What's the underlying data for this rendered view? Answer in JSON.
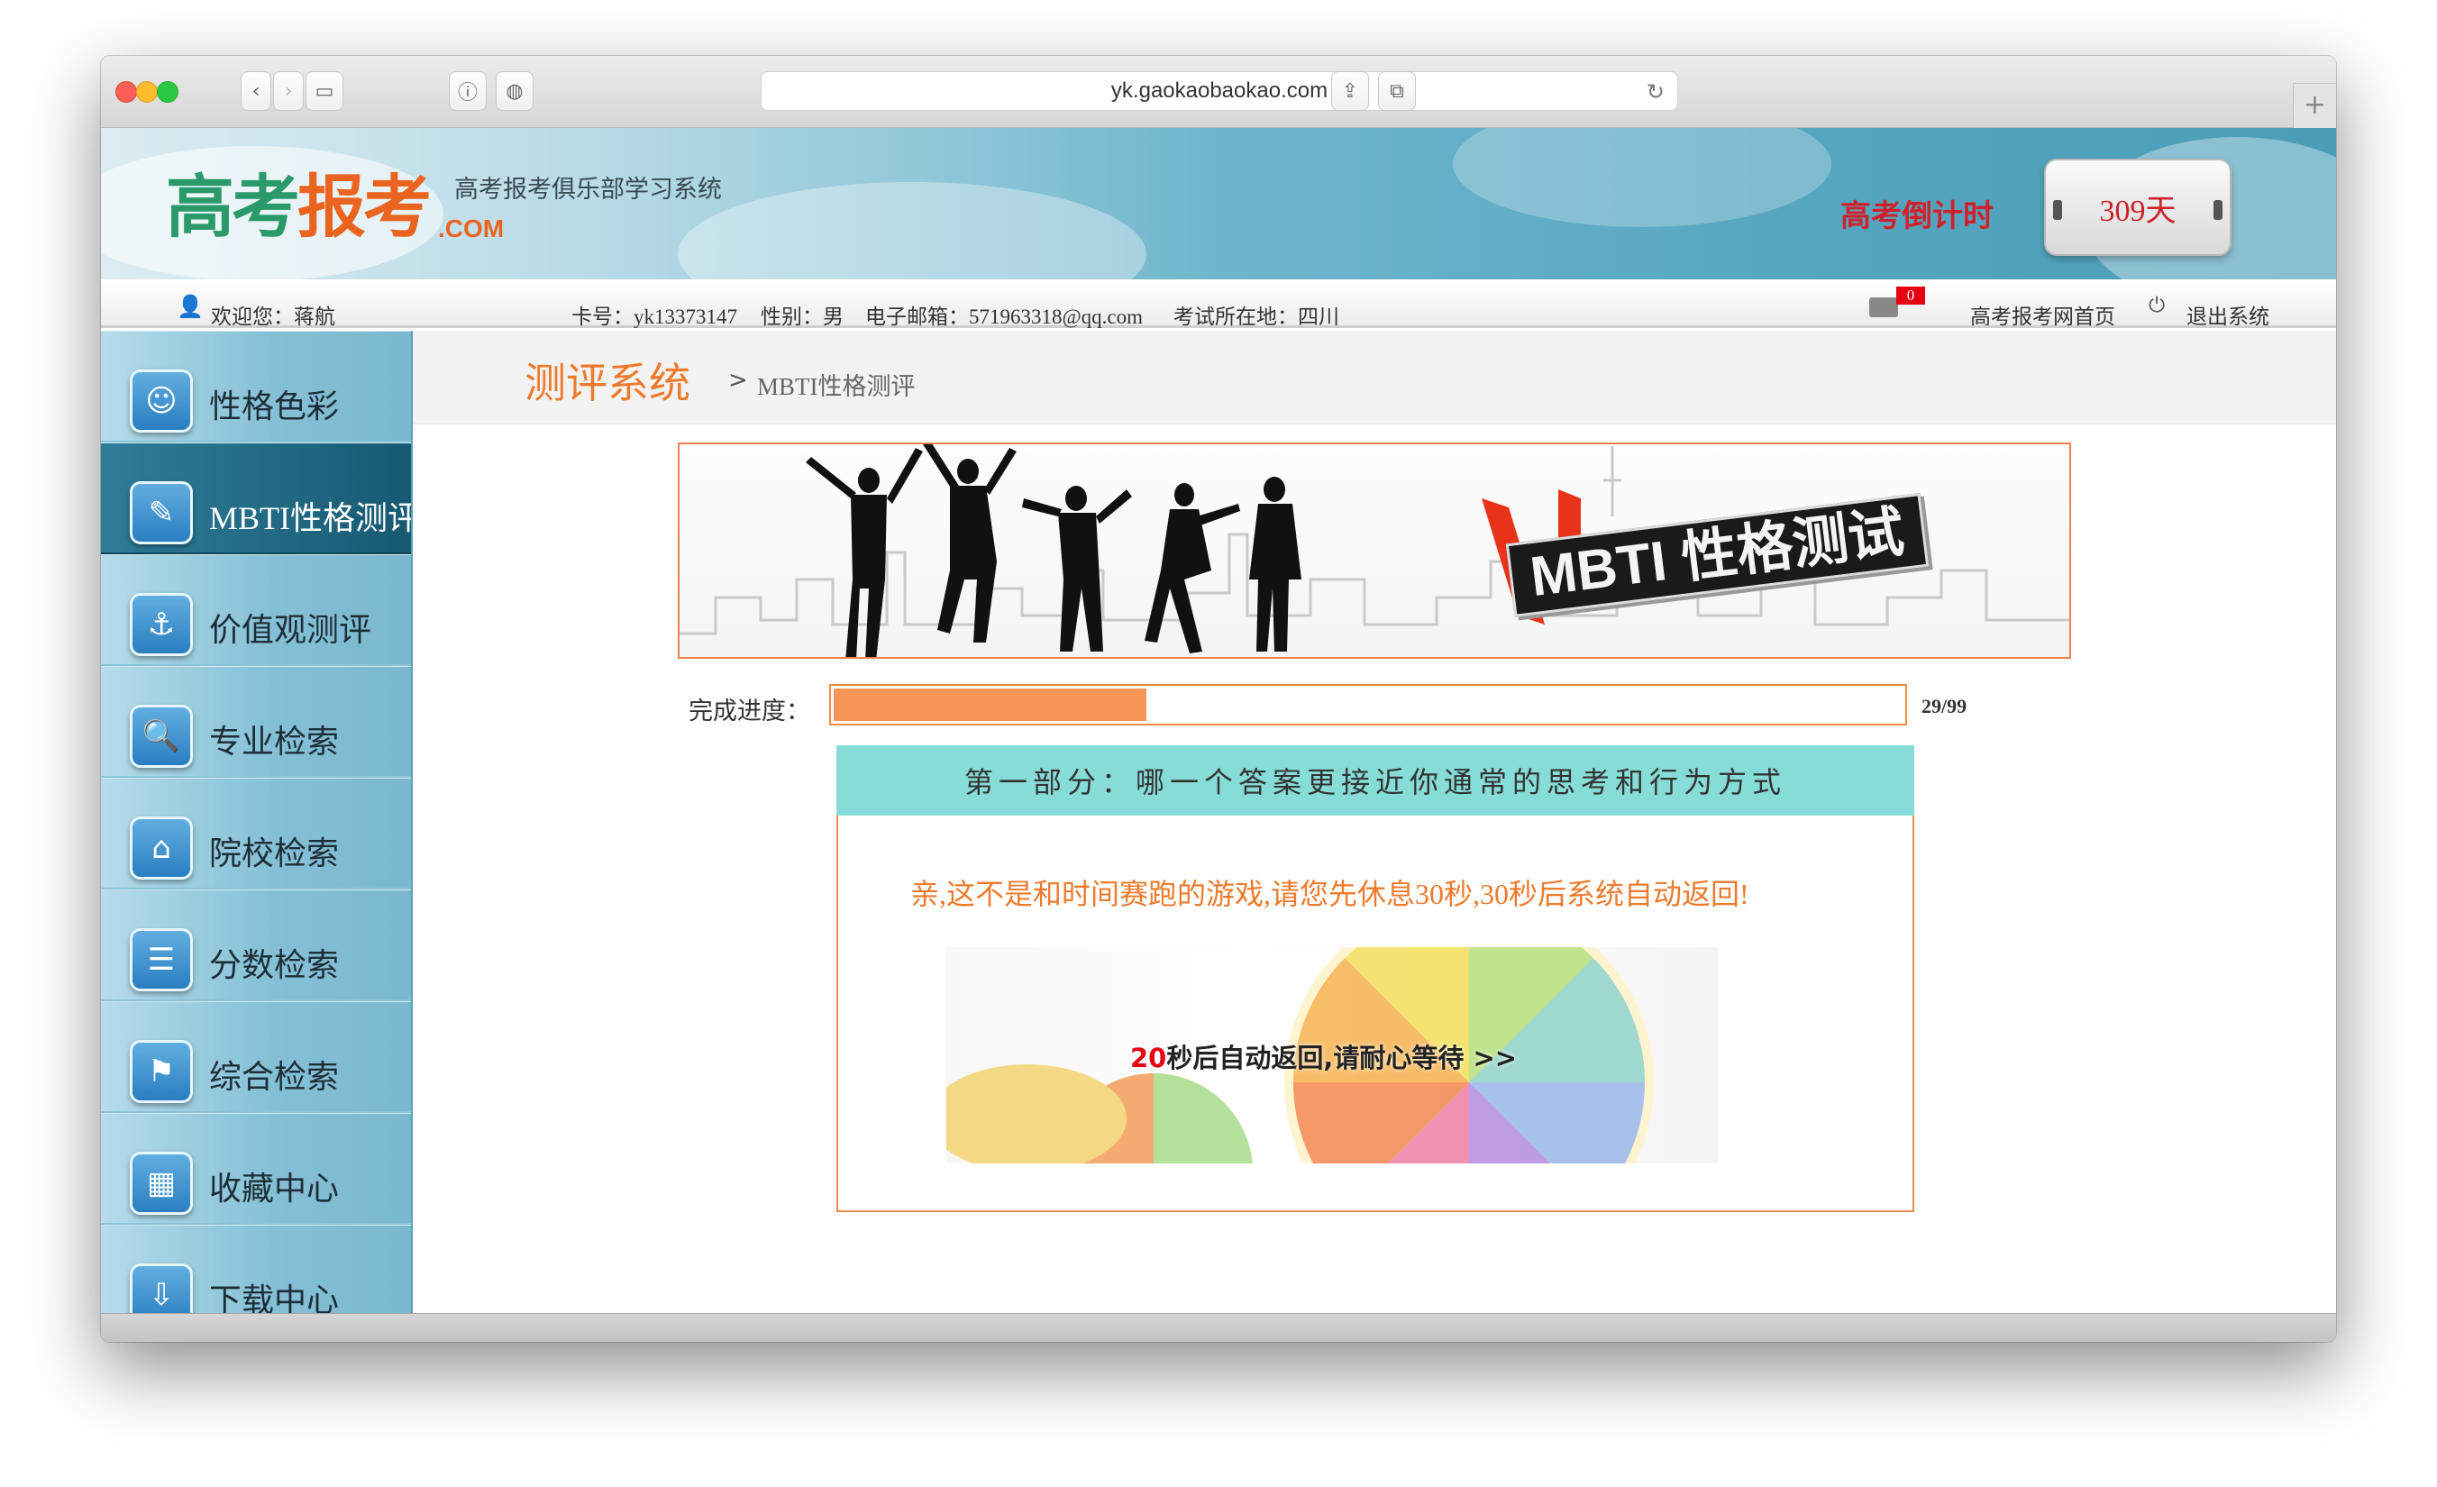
{
  "browser": {
    "url": "yk.gaokaobaokao.com",
    "icons": [
      "back-icon",
      "forward-icon",
      "sidebar-icon",
      "info-icon",
      "shield-icon",
      "reload-icon",
      "share-icon",
      "tabs-icon",
      "new-tab-icon"
    ]
  },
  "header": {
    "logo_part1": "高考",
    "logo_part2": "报考",
    "logo_com": ".COM",
    "slogan": "高考报考俱乐部学习系统",
    "countdown_label": "高考倒计时",
    "countdown_value": "309天"
  },
  "userbar": {
    "welcome": "欢迎您：蒋航",
    "card_no": "卡号：yk13373147",
    "gender": "性别：男",
    "email": "电子邮箱：571963318@qq.com",
    "exam_location": "考试所在地：四川",
    "mail_count": "0",
    "home_link": "高考报考网首页",
    "logout_link": "退出系统"
  },
  "sidebar": {
    "items": [
      {
        "label": "性格色彩",
        "icon": "mask-icon",
        "active": false
      },
      {
        "label": "MBTI性格测评",
        "icon": "feather-icon",
        "active": true
      },
      {
        "label": "价值观测评",
        "icon": "anchor-icon",
        "active": false
      },
      {
        "label": "专业检索",
        "icon": "magnifier-doc-icon",
        "active": false
      },
      {
        "label": "院校检索",
        "icon": "school-search-icon",
        "active": false
      },
      {
        "label": "分数检索",
        "icon": "list-icon",
        "active": false
      },
      {
        "label": "综合检索",
        "icon": "signpost-icon",
        "active": false
      },
      {
        "label": "收藏中心",
        "icon": "building-icon",
        "active": false
      },
      {
        "label": "下载中心",
        "icon": "download-icon",
        "active": false
      }
    ]
  },
  "breadcrumb": {
    "title": "测评系统",
    "separator": ">",
    "current": "MBTI性格测评"
  },
  "hero": {
    "badge_text": "MBTI 性格测试"
  },
  "progress": {
    "label": "完成进度：",
    "count": "29/99",
    "fraction": 0.2929
  },
  "section": {
    "title": "第一部分：哪一个答案更接近你通常的思考和行为方式",
    "message": "亲,这不是和时间赛跑的游戏,请您先休息30秒,30秒后系统自动返回!",
    "wait_seconds": "20",
    "wait_text": "秒后自动返回,请耐心等待 >>"
  },
  "colors": {
    "accent_orange": "#ee7a2c",
    "progress_fill": "#f79556",
    "section_header": "#86dcd6",
    "countdown_red": "#d2202a",
    "active_menu": "#175a72"
  }
}
